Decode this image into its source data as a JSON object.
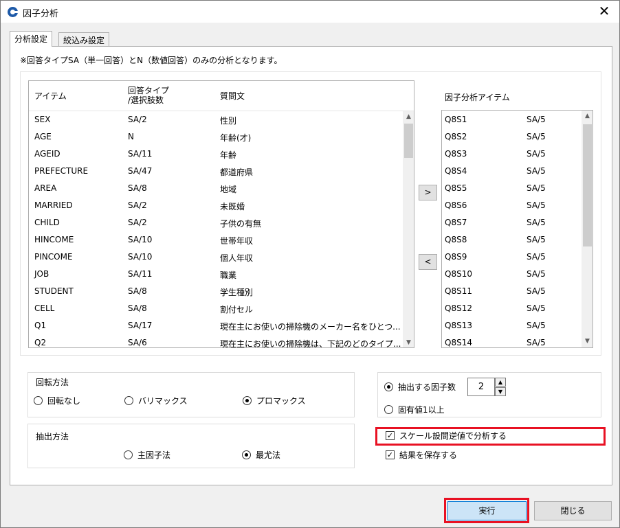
{
  "window": {
    "title": "因子分析",
    "close_glyph": "✕"
  },
  "tabs": [
    {
      "label": "分析設定",
      "active": true
    },
    {
      "label": "絞込み設定",
      "active": false
    }
  ],
  "notice": "※回答タイプSA（単一回答）とN（数値回答）のみの分析となります。",
  "source_list": {
    "headers": {
      "item": "アイテム",
      "type_line1": "回答タイプ",
      "type_line2": "/選択肢数",
      "question": "質問文"
    },
    "rows": [
      {
        "item": "SEX",
        "type": "SA/2",
        "question": "性別"
      },
      {
        "item": "AGE",
        "type": "N",
        "question": "年齢(才)"
      },
      {
        "item": "AGEID",
        "type": "SA/11",
        "question": "年齢"
      },
      {
        "item": "PREFECTURE",
        "type": "SA/47",
        "question": "都道府県"
      },
      {
        "item": "AREA",
        "type": "SA/8",
        "question": "地域"
      },
      {
        "item": "MARRIED",
        "type": "SA/2",
        "question": "未既婚"
      },
      {
        "item": "CHILD",
        "type": "SA/2",
        "question": "子供の有無"
      },
      {
        "item": "HINCOME",
        "type": "SA/10",
        "question": "世帯年収"
      },
      {
        "item": "PINCOME",
        "type": "SA/10",
        "question": "個人年収"
      },
      {
        "item": "JOB",
        "type": "SA/11",
        "question": "職業"
      },
      {
        "item": "STUDENT",
        "type": "SA/8",
        "question": "学生種別"
      },
      {
        "item": "CELL",
        "type": "SA/8",
        "question": "割付セル"
      },
      {
        "item": "Q1",
        "type": "SA/17",
        "question": "現在主にお使いの掃除機のメーカー名をひとつ..."
      },
      {
        "item": "Q2",
        "type": "SA/6",
        "question": "現在主にお使いの掃除機は、下記のどのタイプ..."
      }
    ]
  },
  "move_buttons": {
    "add": ">",
    "remove": "<"
  },
  "target_list": {
    "title": "因子分析アイテム",
    "rows": [
      {
        "item": "Q8S1",
        "type": "SA/5"
      },
      {
        "item": "Q8S2",
        "type": "SA/5"
      },
      {
        "item": "Q8S3",
        "type": "SA/5"
      },
      {
        "item": "Q8S4",
        "type": "SA/5"
      },
      {
        "item": "Q8S5",
        "type": "SA/5"
      },
      {
        "item": "Q8S6",
        "type": "SA/5"
      },
      {
        "item": "Q8S7",
        "type": "SA/5"
      },
      {
        "item": "Q8S8",
        "type": "SA/5"
      },
      {
        "item": "Q8S9",
        "type": "SA/5"
      },
      {
        "item": "Q8S10",
        "type": "SA/5"
      },
      {
        "item": "Q8S11",
        "type": "SA/5"
      },
      {
        "item": "Q8S12",
        "type": "SA/5"
      },
      {
        "item": "Q8S13",
        "type": "SA/5"
      },
      {
        "item": "Q8S14",
        "type": "SA/5"
      }
    ]
  },
  "rotation": {
    "label": "回転方法",
    "options": [
      {
        "label": "回転なし",
        "selected": false
      },
      {
        "label": "バリマックス",
        "selected": false
      },
      {
        "label": "プロマックス",
        "selected": true
      }
    ]
  },
  "extraction": {
    "label": "抽出方法",
    "options": [
      {
        "label": "主因子法",
        "selected": false
      },
      {
        "label": "最尤法",
        "selected": true
      }
    ]
  },
  "factor_count": {
    "fixed_label": "抽出する因子数",
    "fixed_selected": true,
    "value": "2",
    "eigen_label": "固有値1以上",
    "eigen_selected": false
  },
  "checkboxes": {
    "reverse_scale": {
      "label": "スケール設問逆値で分析する",
      "checked": true,
      "check_glyph": "✓"
    },
    "save_result": {
      "label": "結果を保存する",
      "checked": true,
      "check_glyph": "✓"
    }
  },
  "buttons": {
    "run": "実行",
    "close": "閉じる"
  },
  "colors": {
    "highlight": "#e81123",
    "run_button_bg": "#cce4f7",
    "run_button_border": "#0078d7"
  }
}
